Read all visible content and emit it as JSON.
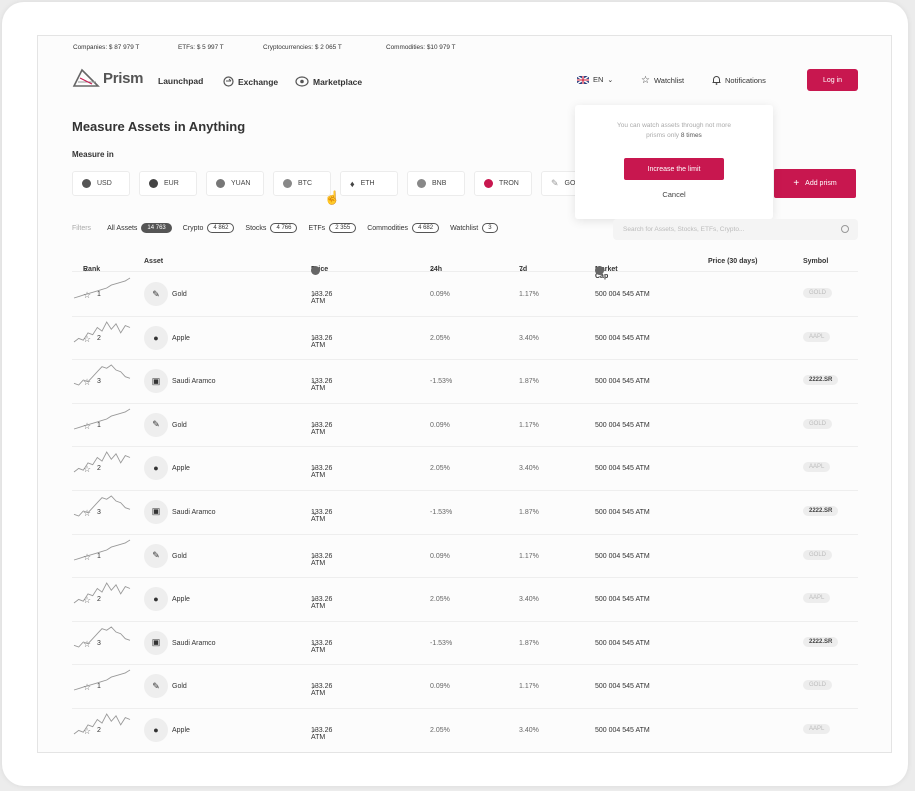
{
  "ticker": [
    {
      "label": "Companies:",
      "value": "$ 87 979 T"
    },
    {
      "label": "ETFs:",
      "value": "$ 5 997 T"
    },
    {
      "label": "Cryptocurrencies:",
      "value": "$ 2 065 T"
    },
    {
      "label": "Commodities:",
      "value": "$10 979 T"
    }
  ],
  "nav": {
    "logo": "Prism",
    "launchpad": "Launchpad",
    "exchange": "Exchange",
    "marketplace": "Marketplace",
    "lang": "EN",
    "watchlist": "Watchlist",
    "notifications": "Notifications",
    "login": "Log in"
  },
  "page": {
    "title": "Measure Assets in Anything",
    "measure_label": "Measure in",
    "add_prism": "Add prism"
  },
  "currencies": [
    {
      "label": "USD",
      "color": "#555555"
    },
    {
      "label": "EUR",
      "color": "#444444"
    },
    {
      "label": "YUAN",
      "color": "#777777"
    },
    {
      "label": "BTC",
      "color": "#888888"
    },
    {
      "label": "ETH",
      "color": "#333333"
    },
    {
      "label": "BNB",
      "color": "#888888"
    },
    {
      "label": "TRON",
      "color": "#c8174f"
    },
    {
      "label": "GO",
      "color": "#999999"
    }
  ],
  "popup": {
    "line1": "You can watch assets through not more",
    "line2_prefix": "prisms only",
    "line2_bold": "8 times",
    "button": "Increase the limit",
    "cancel": "Cancel"
  },
  "filters": {
    "label": "Filters",
    "items": [
      {
        "label": "All Assets",
        "count": "14 763",
        "active": true
      },
      {
        "label": "Crypto",
        "count": "4 862",
        "active": false
      },
      {
        "label": "Stocks",
        "count": "4 766",
        "active": false
      },
      {
        "label": "ETFs",
        "count": "2 355",
        "active": false
      },
      {
        "label": "Commodities",
        "count": "4 682",
        "active": false
      },
      {
        "label": "Watchlist",
        "count": "3",
        "active": false
      }
    ]
  },
  "search": {
    "placeholder": "Search for Assets, Stocks, ETFs, Crypto..."
  },
  "table": {
    "headers": {
      "rank": "Rank",
      "asset": "Asset",
      "price": "Price",
      "h24": "24h",
      "d7": "7d",
      "mcap": "Market Cap",
      "chart": "Price (30 days)",
      "symbol": "Symbol"
    },
    "rows": [
      {
        "rank": "1",
        "asset": "Gold",
        "price": "133.26 ATM",
        "h24": "0.09%",
        "d7": "1.17%",
        "mcap": "500 004 545 ATM",
        "symbol": "GOLD",
        "trend": [
          3,
          4,
          5,
          6,
          7,
          8,
          9,
          10,
          12,
          13,
          14,
          15,
          17
        ]
      },
      {
        "rank": "2",
        "asset": "Apple",
        "price": "133.26 ATM",
        "h24": "2.05%",
        "d7": "3.40%",
        "mcap": "500 004 545 ATM",
        "symbol": "AAPL",
        "trend": [
          4,
          6,
          5,
          9,
          8,
          12,
          10,
          15,
          11,
          14,
          9,
          13,
          12
        ]
      },
      {
        "rank": "3",
        "asset": "Saudi Aramco",
        "price": "133.26 ATM",
        "h24": "-1.53%",
        "d7": "1.87%",
        "mcap": "500 004 545 ATM",
        "symbol": "2222.SR",
        "trend": [
          5,
          4,
          7,
          6,
          9,
          12,
          15,
          14,
          16,
          13,
          12,
          9,
          8
        ]
      },
      {
        "rank": "1",
        "asset": "Gold",
        "price": "133.26 ATM",
        "h24": "0.09%",
        "d7": "1.17%",
        "mcap": "500 004 545 ATM",
        "symbol": "GOLD",
        "trend": [
          3,
          4,
          5,
          6,
          7,
          8,
          9,
          10,
          12,
          13,
          14,
          15,
          17
        ]
      },
      {
        "rank": "2",
        "asset": "Apple",
        "price": "133.26 ATM",
        "h24": "2.05%",
        "d7": "3.40%",
        "mcap": "500 004 545 ATM",
        "symbol": "AAPL",
        "trend": [
          4,
          6,
          5,
          9,
          8,
          12,
          10,
          15,
          11,
          14,
          9,
          13,
          12
        ]
      },
      {
        "rank": "3",
        "asset": "Saudi Aramco",
        "price": "133.26 ATM",
        "h24": "-1.53%",
        "d7": "1.87%",
        "mcap": "500 004 545 ATM",
        "symbol": "2222.SR",
        "trend": [
          5,
          4,
          7,
          6,
          9,
          12,
          15,
          14,
          16,
          13,
          12,
          9,
          8
        ]
      },
      {
        "rank": "1",
        "asset": "Gold",
        "price": "133.26 ATM",
        "h24": "0.09%",
        "d7": "1.17%",
        "mcap": "500 004 545 ATM",
        "symbol": "GOLD",
        "trend": [
          3,
          4,
          5,
          6,
          7,
          8,
          9,
          10,
          12,
          13,
          14,
          15,
          17
        ]
      },
      {
        "rank": "2",
        "asset": "Apple",
        "price": "133.26 ATM",
        "h24": "2.05%",
        "d7": "3.40%",
        "mcap": "500 004 545 ATM",
        "symbol": "AAPL",
        "trend": [
          4,
          6,
          5,
          9,
          8,
          12,
          10,
          15,
          11,
          14,
          9,
          13,
          12
        ]
      },
      {
        "rank": "3",
        "asset": "Saudi Aramco",
        "price": "133.26 ATM",
        "h24": "-1.53%",
        "d7": "1.87%",
        "mcap": "500 004 545 ATM",
        "symbol": "2222.SR",
        "trend": [
          5,
          4,
          7,
          6,
          9,
          12,
          15,
          14,
          16,
          13,
          12,
          9,
          8
        ]
      },
      {
        "rank": "1",
        "asset": "Gold",
        "price": "133.26 ATM",
        "h24": "0.09%",
        "d7": "1.17%",
        "mcap": "500 004 545 ATM",
        "symbol": "GOLD",
        "trend": [
          3,
          4,
          5,
          6,
          7,
          8,
          9,
          10,
          12,
          13,
          14,
          15,
          17
        ]
      },
      {
        "rank": "2",
        "asset": "Apple",
        "price": "133.26 ATM",
        "h24": "2.05%",
        "d7": "3.40%",
        "mcap": "500 004 545 ATM",
        "symbol": "AAPL",
        "trend": [
          4,
          6,
          5,
          9,
          8,
          12,
          10,
          15,
          11,
          14,
          9,
          13,
          12
        ]
      }
    ]
  },
  "colors": {
    "accent": "#c8174f"
  }
}
